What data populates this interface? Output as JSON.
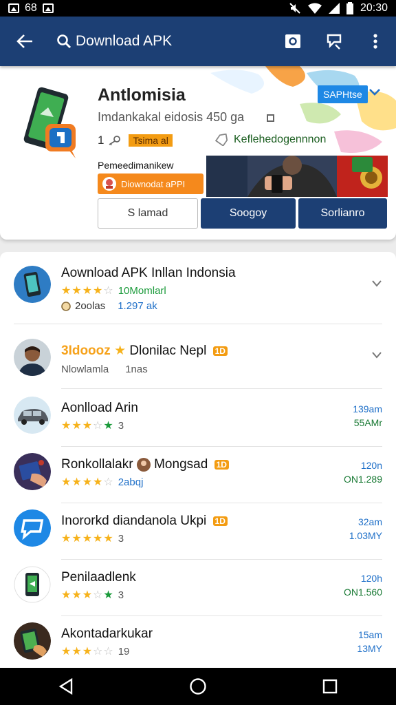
{
  "status_bar": {
    "left_text": "68",
    "time": "20:30"
  },
  "app_bar": {
    "title": "Download APK"
  },
  "header": {
    "app_name": "Antlomisia",
    "subtitle": "Imdankakal eidosis 450 ga",
    "rating_number": "1",
    "badge": "Tsima al",
    "developer": "Keflehedogennnon",
    "install_button": "SAPHtse",
    "promo_label": "Pemeedimanikew",
    "promo_button": "Diownodat aPPI",
    "buttons": [
      "S lamad",
      "Soogoy",
      "Sorlianro"
    ]
  },
  "list": [
    {
      "title": "Aownload APK Inllan Indonsia",
      "stars": [
        1,
        1,
        1,
        1,
        0
      ],
      "meta": "10Momlarl",
      "sub1": "2oolas",
      "sub2": "1.297 ak"
    },
    {
      "title_accent": "3Idoooz",
      "title": "Dlonilac Nepl",
      "pill": "1D",
      "sub": "Nlowlamla",
      "sub2": "1nas"
    },
    {
      "title": "Aonlload Arin",
      "stars": [
        1,
        1,
        1,
        0,
        2
      ],
      "meta": "3",
      "right_top": "139am",
      "right_bot": "55AMr"
    },
    {
      "title": "Ronkollalakr",
      "title2": "Mongsad",
      "pill": "1D",
      "stars": [
        1,
        1,
        1,
        1,
        0
      ],
      "meta": "2abqj",
      "right_top": "120n",
      "right_bot": "ON1.289"
    },
    {
      "title": "Inororkd diandanola Ukpi",
      "pill": "1D",
      "stars": [
        1,
        1,
        1,
        1,
        1
      ],
      "meta": "3",
      "right_top": "32am",
      "right_bot": "1.03MY"
    },
    {
      "title": "Penilaadlenk",
      "stars": [
        1,
        1,
        1,
        0,
        2
      ],
      "meta": "3",
      "right_top": "120h",
      "right_bot": "ON1.560"
    },
    {
      "title": "Akontadarkukar",
      "stars": [
        1,
        1,
        1,
        0,
        0
      ],
      "meta": "19",
      "right_top": "15am",
      "right_bot": "13MY"
    }
  ],
  "colors": {
    "primary": "#1c3f74",
    "accent_orange": "#f39c12",
    "star": "#f6b21b",
    "green": "#1a9a3a",
    "blue": "#1e6fc8"
  }
}
